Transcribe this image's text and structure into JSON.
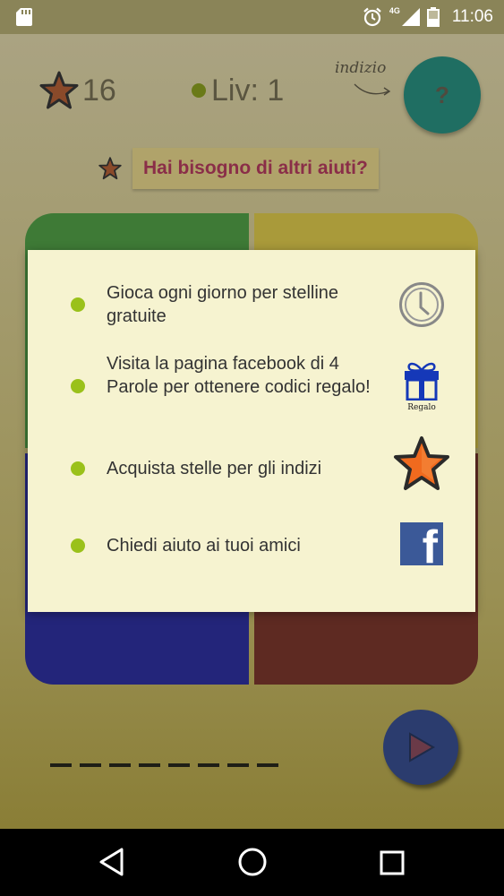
{
  "status_bar": {
    "time": "11:06",
    "network": "4G",
    "icons": [
      "sd-card-icon",
      "alarm-clock-icon",
      "signal-icon",
      "battery-icon"
    ]
  },
  "game": {
    "stars_count": "16",
    "level_label": "Liv: 1",
    "hint_label": "indizio",
    "hint_button_label": "?",
    "help_button_label": "Hai bisogno di altri aiuti?"
  },
  "dialog": {
    "tips": [
      {
        "text": "Gioca ogni giorno per stelline gratuite",
        "icon": "clock-icon"
      },
      {
        "text": "Visita la pagina facebook di 4 Parole per ottenere codici regalo!",
        "icon": "gift-icon",
        "icon_caption": "Regalo"
      },
      {
        "text": "Acquista stelle per gli indizi",
        "icon": "star-icon"
      },
      {
        "text": "Chiedi aiuto ai tuoi amici",
        "icon": "facebook-icon",
        "icon_letter": "f"
      }
    ]
  },
  "colors": {
    "accent_green": "#9ac11a",
    "dialog_bg": "#f6f3d0",
    "facebook_blue": "#3b5998",
    "gift_blue": "#1538b8",
    "star_orange": "#f06a1e"
  },
  "navigation": {
    "buttons": [
      "back-icon",
      "home-icon",
      "recents-icon"
    ]
  }
}
